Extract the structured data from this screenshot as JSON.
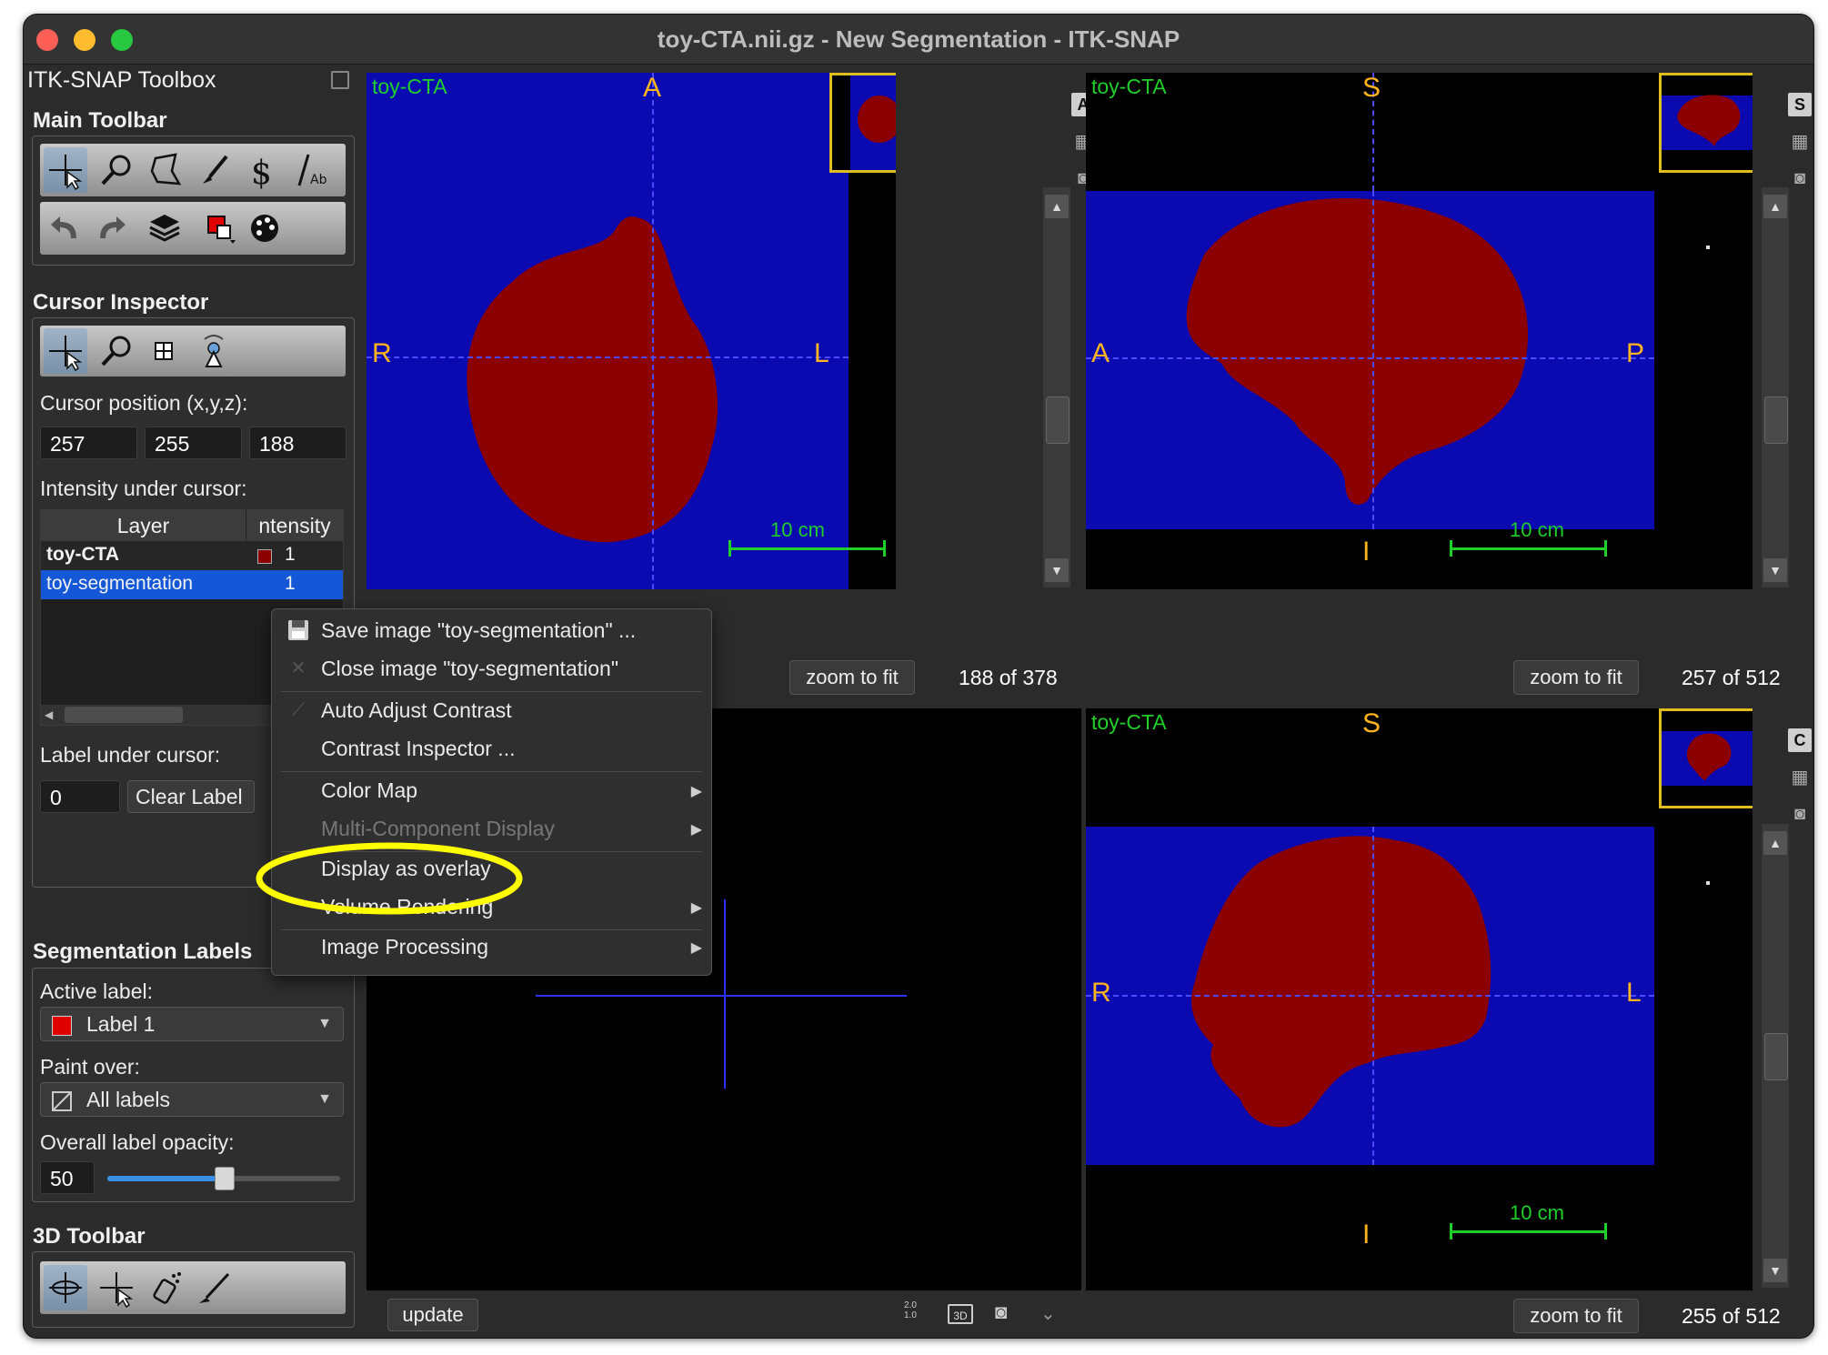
{
  "window": {
    "title": "toy-CTA.nii.gz - New Segmentation - ITK-SNAP"
  },
  "toolbox": {
    "title": "ITK-SNAP Toolbox",
    "main_toolbar": {
      "title": "Main Toolbar",
      "row1_icons": [
        "crosshair-cursor-icon",
        "zoom-icon",
        "polygon-icon",
        "paintbrush-icon",
        "snake-icon",
        "annotation-icon"
      ],
      "row2_icons": [
        "undo-icon",
        "redo-icon",
        "layers-icon",
        "label-color-icon",
        "palette-icon"
      ]
    },
    "cursor_inspector": {
      "title": "Cursor Inspector",
      "position_label": "Cursor position (x,y,z):",
      "x": "257",
      "y": "255",
      "z": "188",
      "intensity_label": "Intensity under cursor:",
      "columns": [
        "Layer",
        "ntensity"
      ],
      "rows": [
        {
          "layer": "toy-CTA",
          "value": "1"
        },
        {
          "layer": "toy-segmentation",
          "value": "1"
        }
      ],
      "label_under_cursor": "Label under cursor:",
      "label_value": "0",
      "clear_label": "Clear Label"
    },
    "segmentation_labels": {
      "title": "Segmentation Labels",
      "active_label_caption": "Active label:",
      "active_label": "Label 1",
      "paint_over_caption": "Paint over:",
      "paint_over": "All labels",
      "opacity_caption": "Overall label opacity:",
      "opacity_value": "50",
      "opacity_fraction": 0.5
    },
    "toolbar_3d": {
      "title": "3D Toolbar"
    }
  },
  "views": {
    "axial": {
      "name": "toy-CTA",
      "top": "A",
      "left": "R",
      "right": "L",
      "scale": "10 cm",
      "zoom_btn": "zoom to fit",
      "slice": "188 of 378",
      "side_letter": "A"
    },
    "sagittal": {
      "name": "toy-CTA",
      "top": "S",
      "left": "A",
      "right": "P",
      "bottom": "I",
      "scale": "10 cm",
      "zoom_btn": "zoom to fit",
      "slice": "257 of 512",
      "side_letter": "S"
    },
    "coronal": {
      "name": "toy-CTA",
      "top": "S",
      "left": "R",
      "right": "L",
      "bottom": "I",
      "scale": "10 cm",
      "zoom_btn": "zoom to fit",
      "slice": "255 of 512",
      "side_letter": "C"
    },
    "render3d": {
      "update_btn": "update"
    }
  },
  "context_menu": {
    "items": [
      {
        "label": "Save image \"toy-segmentation\" ...",
        "icon": "save-icon"
      },
      {
        "label": "Close image \"toy-segmentation\"",
        "icon": "close-icon"
      },
      {
        "label": "Auto Adjust Contrast",
        "icon": "contrast-wand-icon"
      },
      {
        "label": "Contrast Inspector ..."
      },
      {
        "label": "Color Map",
        "submenu": true
      },
      {
        "label": "Multi-Component Display",
        "submenu": true,
        "disabled": true
      },
      {
        "label": "Display as overlay"
      },
      {
        "label": "Volume Rendering",
        "submenu": true
      },
      {
        "label": "Image Processing",
        "submenu": true
      }
    ]
  },
  "colors": {
    "view_background": "#0a0ab0",
    "segmentation": "#8b0000",
    "crosshair": "#4a4aff",
    "highlight": "#ffff00"
  }
}
